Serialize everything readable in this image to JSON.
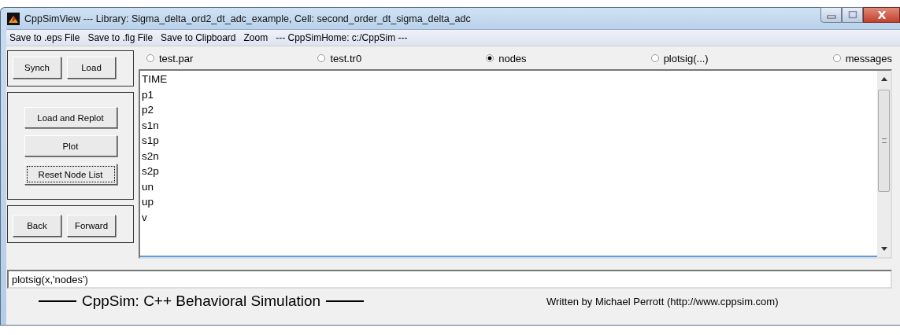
{
  "window": {
    "title": "CppSimView --- Library: Sigma_delta_ord2_dt_adc_example, Cell: second_order_dt_sigma_delta_adc"
  },
  "menu": [
    "Save to .eps File",
    "Save to .fig File",
    "Save to Clipboard",
    "Zoom",
    "--- CppSimHome: c:/CppSim ---"
  ],
  "button_groups": [
    [
      {
        "label": "Synch",
        "focused": false
      },
      {
        "label": "Load",
        "focused": false
      }
    ],
    [
      {
        "label": "Load and Replot",
        "focused": false
      },
      {
        "label": "Plot",
        "focused": false
      },
      {
        "label": "Reset Node List",
        "focused": true
      }
    ],
    [
      {
        "label": "Back",
        "focused": false
      },
      {
        "label": "Forward",
        "focused": false
      }
    ]
  ],
  "radios": [
    {
      "label": "test.par",
      "selected": false
    },
    {
      "label": "test.tr0",
      "selected": false
    },
    {
      "label": "nodes",
      "selected": true
    },
    {
      "label": "plotsig(...)",
      "selected": false
    },
    {
      "label": "messages",
      "selected": false
    }
  ],
  "node_list": [
    "TIME",
    "p1",
    "p2",
    "s1n",
    "s1p",
    "s2n",
    "s2p",
    "un",
    "up",
    "v"
  ],
  "command": {
    "value": "plotsig(x,'nodes')"
  },
  "footer": {
    "banner": "CppSim:  C++ Behavioral Simulation",
    "credit": "Written by Michael Perrott  (http://www.cppsim.com)"
  }
}
